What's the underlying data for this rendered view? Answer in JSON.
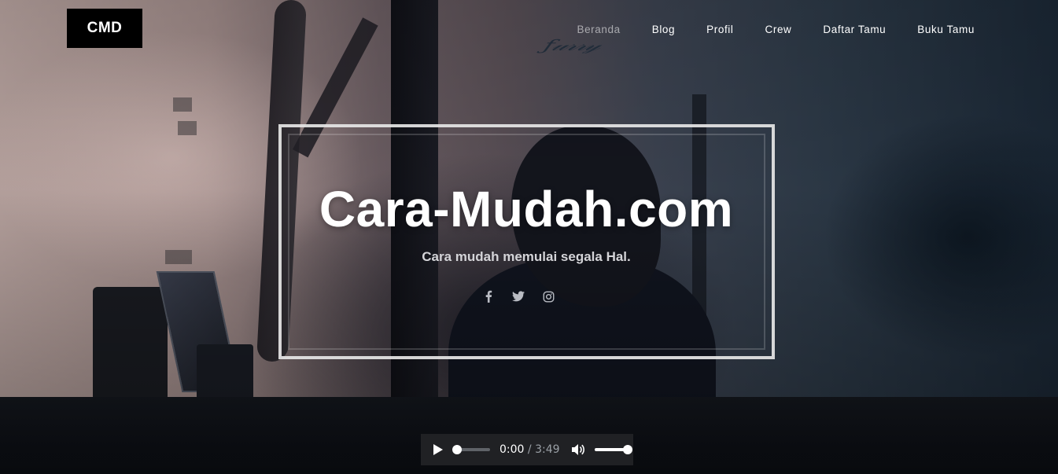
{
  "header": {
    "logo_text": "CMD",
    "nav": [
      {
        "label": "Beranda",
        "active": true
      },
      {
        "label": "Blog",
        "active": false
      },
      {
        "label": "Profil",
        "active": false
      },
      {
        "label": "Crew",
        "active": false
      },
      {
        "label": "Daftar Tamu",
        "active": false
      },
      {
        "label": "Buku Tamu",
        "active": false
      }
    ]
  },
  "hero": {
    "title": "Cara-Mudah.com",
    "tagline": "Cara mudah memulai segala Hal.",
    "social_icons": [
      "facebook-icon",
      "twitter-icon",
      "instagram-icon"
    ]
  },
  "audio_player": {
    "current_time": "0:00",
    "separator": " / ",
    "duration": "3:49",
    "progress_fraction": 0,
    "volume_fraction": 1
  },
  "colors": {
    "logo_bg": "#000000",
    "text_primary": "#ffffff",
    "tagline": "#d4d4d8",
    "player_bg": "#202124"
  }
}
